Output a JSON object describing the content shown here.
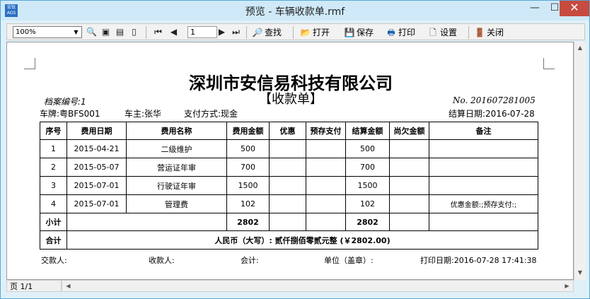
{
  "window": {
    "app_icon_text": "宏钛 AGS",
    "title": "预览 - 车辆收款单.rmf",
    "min_symbol": "—",
    "max_symbol": "☐",
    "close_symbol": "✕"
  },
  "toolbar": {
    "zoom_value": "100%",
    "page_value": "1",
    "find_label": "查找",
    "open_label": "打开",
    "save_label": "保存",
    "print_label": "打印",
    "settings_label": "设置",
    "close_label": "关闭"
  },
  "status": {
    "page_indicator": "页 1/1"
  },
  "document": {
    "company": "深圳市安信易科技有限公司",
    "subtitle": "【收款单】",
    "archive_no": "档案编号:1",
    "doc_no": "No. 201607281005",
    "plate": "车牌:粤BFS001",
    "owner": "车主:张华",
    "payment": "支付方式:现金",
    "settle_date": "结算日期:2016-07-28",
    "headers": [
      "序号",
      "费用日期",
      "费用名称",
      "费用金额",
      "优惠",
      "预存支付",
      "结算金额",
      "尚欠金额",
      "备注"
    ],
    "rows": [
      [
        "1",
        "2015-04-21",
        "二级维护",
        "500",
        "",
        "",
        "500",
        "",
        ""
      ],
      [
        "2",
        "2015-05-07",
        "营运证年审",
        "700",
        "",
        "",
        "700",
        "",
        ""
      ],
      [
        "3",
        "2015-07-01",
        "行驶证年审",
        "1500",
        "",
        "",
        "1500",
        "",
        ""
      ],
      [
        "4",
        "2015-07-01",
        "管理费",
        "102",
        "",
        "",
        "102",
        "",
        "优惠金额:;预存支付:;"
      ]
    ],
    "subtotal_label": "小计",
    "subtotal_amount": "2802",
    "subtotal_settle": "2802",
    "total_label": "合计",
    "total_text": "人民币（大写）: 贰仟捌佰零贰元整  (￥2802.00)",
    "payer": "交款人:",
    "payee": "收款人:",
    "accountant": "会计:",
    "unit": "单位（盖章）:",
    "print_date": "打印日期:2016-07-28 17:41:38"
  }
}
